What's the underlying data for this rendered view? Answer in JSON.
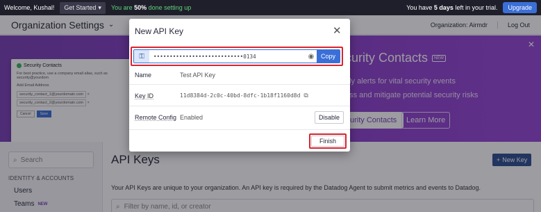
{
  "topbar": {
    "welcome": "Welcome, Kushal!",
    "get_started": "Get Started",
    "done_prefix": "You are ",
    "done_pct": "50%",
    "done_suffix": " done setting up",
    "trial_prefix": "You have ",
    "trial_days": "5 days",
    "trial_suffix": " left in your trial.",
    "upgrade": "Upgrade"
  },
  "header": {
    "title": "Organization Settings",
    "organization": "Organization: Airmdr",
    "logout": "Log Out"
  },
  "banner": {
    "headline": "curity Contacts",
    "headline_badge": "NEW",
    "line1": "ely alerts for vital security events",
    "line2": "ess and mitigate potential security risks",
    "primary_button": "urity Contacts",
    "secondary_button": "Learn More",
    "preview": {
      "title": "Security Contacts",
      "hint": "For best practice, use a company email alias, such as security@yourdom",
      "field_label": "Add Email Address",
      "chips": [
        "security_contact_1@yourdomain.com",
        "security_contact_2@yourdomain.com"
      ],
      "cancel": "Cancel",
      "save": "Save"
    }
  },
  "sidebar": {
    "search_placeholder": "Search",
    "section": "IDENTITY & ACCOUNTS",
    "items": [
      {
        "label": "Users",
        "badge": ""
      },
      {
        "label": "Teams",
        "badge": "NEW"
      }
    ]
  },
  "main": {
    "title": "API Keys",
    "new_key_button": "New Key",
    "description": "Your API Keys are unique to your organization. An API key is required by the Datadog Agent to submit metrics and events to Datadog.",
    "filter_placeholder": "Filter by name, id, or creator"
  },
  "modal": {
    "title": "New API Key",
    "masked_key": "••••••••••••••••••••••••••••0134",
    "copy_label": "Copy",
    "name_label": "Name",
    "name_value": "Test API Key",
    "keyid_label": "Key ID",
    "keyid_value": "11d8384d-2c0c-40bd-8dfc-1b18f1160d8d",
    "remote_label": "Remote Config",
    "remote_value": "Enabled",
    "disable_label": "Disable",
    "finish_label": "Finish"
  }
}
